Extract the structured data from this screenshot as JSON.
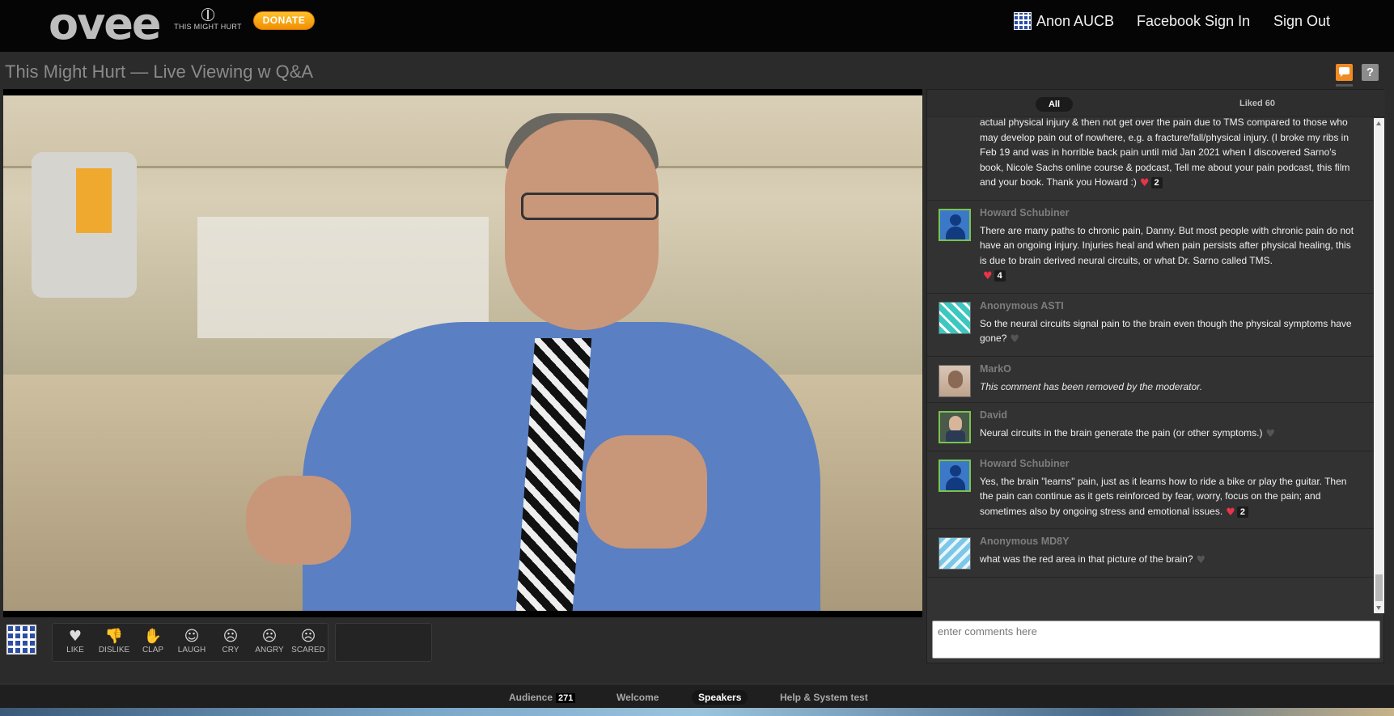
{
  "header": {
    "logo": "ovee",
    "logo_sub": "THIS MIGHT HURT",
    "donate_label": "DONATE",
    "user_name": "Anon AUCB",
    "facebook_label": "Facebook Sign In",
    "signout_label": "Sign Out"
  },
  "page_title": "This Might Hurt — Live Viewing w Q&A",
  "icons": {
    "chat": "chat-bubble-icon",
    "help": "?"
  },
  "reactions": [
    {
      "icon": "♥",
      "label": "LIKE"
    },
    {
      "icon": "👎",
      "label": "DISLIKE"
    },
    {
      "icon": "✋",
      "label": "CLAP"
    },
    {
      "icon": "☺",
      "label": "LAUGH"
    },
    {
      "icon": "☹",
      "label": "CRY"
    },
    {
      "icon": "☹",
      "label": "ANGRY"
    },
    {
      "icon": "☹",
      "label": "SCARED"
    }
  ],
  "panel": {
    "tab_all": "All",
    "tab_liked": "Liked 60",
    "input_placeholder": "enter comments here"
  },
  "comments": [
    {
      "name": "",
      "text": "actual physical injury & then not get over the pain due to TMS compared to those who may develop pain out of nowhere, e.g. a fracture/fall/physical injury. (I broke my ribs in Feb 19 and was in horrible back pain until mid Jan 2021 when I discovered Sarno's book, Nicole Sachs online course & podcast, Tell me about your pain podcast, this film and your book. Thank you Howard :)",
      "likes": "2"
    },
    {
      "name": "Howard Schubiner",
      "text": "There are many paths to chronic pain, Danny. But most people with chronic pain do not have an ongoing injury. Injuries heal and when pain persists after physical healing, this is due to brain derived neural circuits, or what Dr. Sarno called TMS.",
      "likes": "4"
    },
    {
      "name": "Anonymous ASTI",
      "text": "So the neural circuits signal pain to the brain even though the physical symptoms have gone?",
      "likes": ""
    },
    {
      "name": "MarkO",
      "text": "This comment has been removed by the moderator.",
      "likes": ""
    },
    {
      "name": "David",
      "text": "Neural circuits in the brain generate the pain (or other symptoms.)",
      "likes": ""
    },
    {
      "name": "Howard Schubiner",
      "text": "Yes, the brain \"learns\" pain, just as it learns how to ride a bike or play the guitar. Then the pain can continue as it gets reinforced by fear, worry, focus on the pain; and sometimes also by ongoing stress and emotional issues.",
      "likes": "2"
    },
    {
      "name": "Anonymous MD8Y",
      "text": "what was the red area in that picture of the brain?",
      "likes": ""
    }
  ],
  "bottom_tabs": {
    "audience": "Audience",
    "audience_count": "271",
    "welcome": "Welcome",
    "speakers": "Speakers",
    "help": "Help & System test"
  }
}
